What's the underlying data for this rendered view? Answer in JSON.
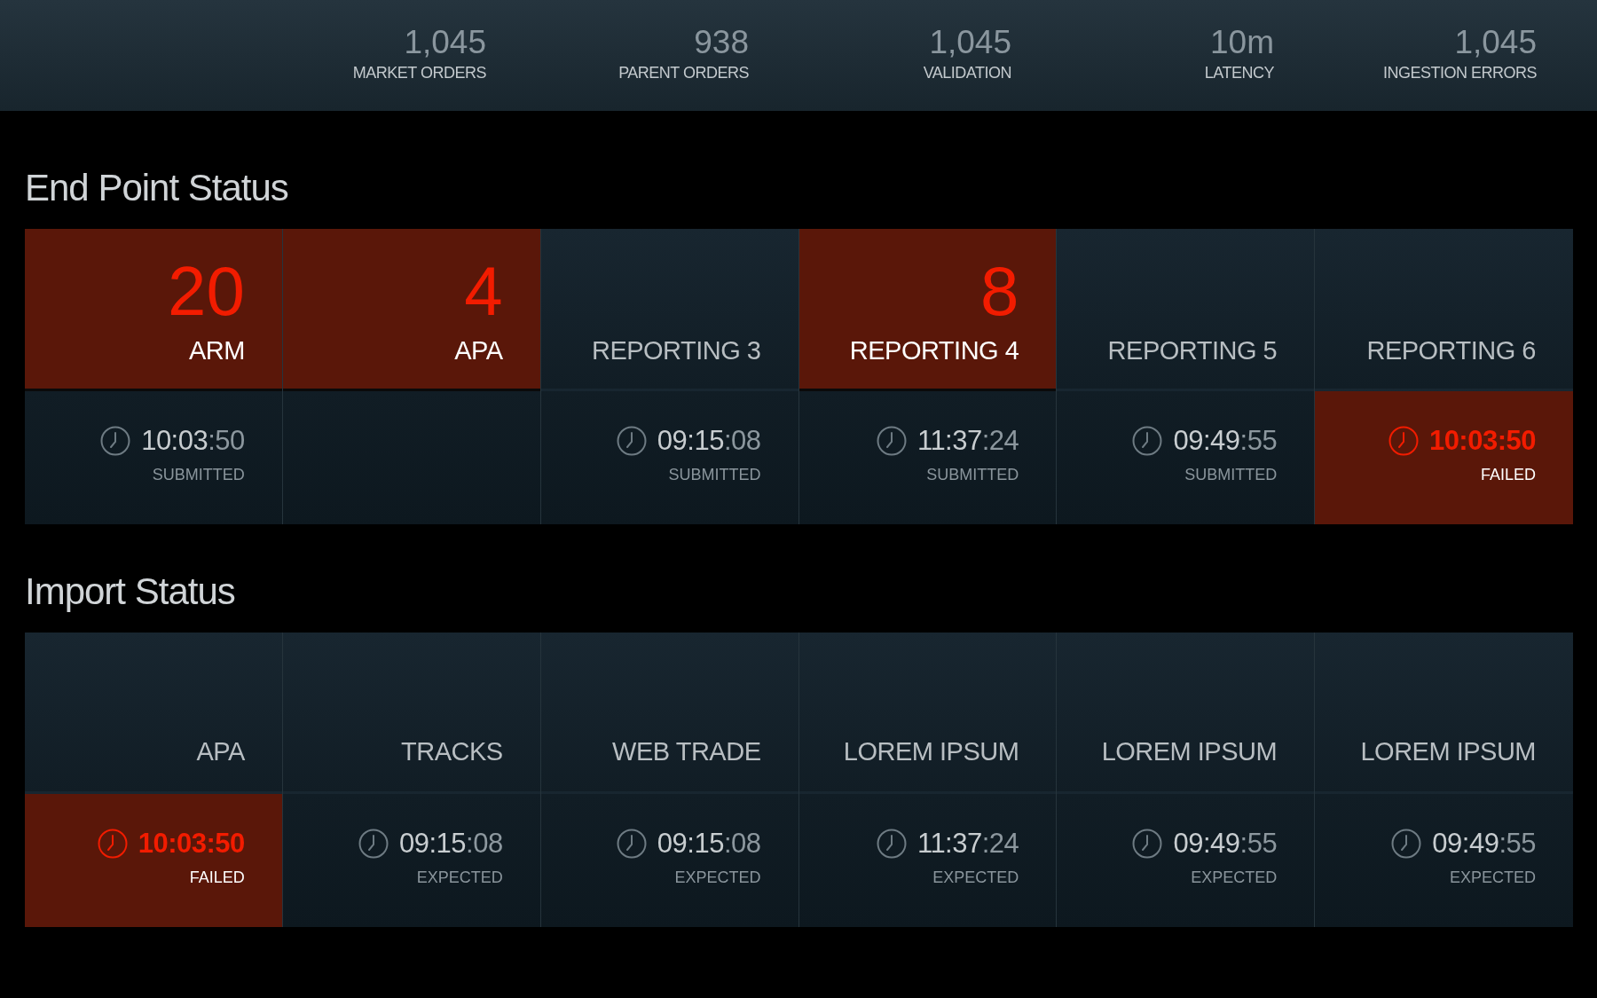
{
  "stats": [
    {
      "value": "1,045",
      "label": "MARKET ORDERS"
    },
    {
      "value": "938",
      "label": "PARENT ORDERS"
    },
    {
      "value": "1,045",
      "label": "VALIDATION"
    },
    {
      "value": "10m",
      "label": "LATENCY"
    },
    {
      "value": "1,045",
      "label": "INGESTION ERRORS"
    }
  ],
  "sections": [
    {
      "title": "End Point Status",
      "columns": [
        {
          "count": "20",
          "name": "ARM",
          "alert": true,
          "time": {
            "main": "10:03",
            "seconds": ":50",
            "status": "SUBMITTED",
            "failed": false
          }
        },
        {
          "count": "4",
          "name": "APA",
          "alert": true
        },
        {
          "name": "REPORTING 3",
          "alert": false,
          "time": {
            "main": "09:15",
            "seconds": ":08",
            "status": "SUBMITTED",
            "failed": false
          }
        },
        {
          "count": "8",
          "name": "REPORTING 4",
          "alert": true,
          "time": {
            "main": "11:37",
            "seconds": ":24",
            "status": "SUBMITTED",
            "failed": false
          }
        },
        {
          "name": "REPORTING 5",
          "alert": false,
          "time": {
            "main": "09:49",
            "seconds": ":55",
            "status": "SUBMITTED",
            "failed": false
          }
        },
        {
          "name": "REPORTING 6",
          "alert": false,
          "time": {
            "main": "10:03",
            "seconds": ":50",
            "status": "FAILED",
            "failed": true
          }
        }
      ]
    },
    {
      "title": "Import Status",
      "columns": [
        {
          "name": "APA",
          "alert": false,
          "time": {
            "main": "10:03",
            "seconds": ":50",
            "status": "FAILED",
            "failed": true
          }
        },
        {
          "name": "TRACKS",
          "alert": false,
          "time": {
            "main": "09:15",
            "seconds": ":08",
            "status": "EXPECTED",
            "failed": false
          }
        },
        {
          "name": "WEB TRADE",
          "alert": false,
          "time": {
            "main": "09:15",
            "seconds": ":08",
            "status": "EXPECTED",
            "failed": false
          }
        },
        {
          "name": "LOREM IPSUM",
          "alert": false,
          "time": {
            "main": "11:37",
            "seconds": ":24",
            "status": "EXPECTED",
            "failed": false
          }
        },
        {
          "name": "LOREM IPSUM",
          "alert": false,
          "time": {
            "main": "09:49",
            "seconds": ":55",
            "status": "EXPECTED",
            "failed": false
          }
        },
        {
          "name": "LOREM IPSUM",
          "alert": false,
          "time": {
            "main": "09:49",
            "seconds": ":55",
            "status": "EXPECTED",
            "failed": false
          }
        }
      ]
    }
  ]
}
